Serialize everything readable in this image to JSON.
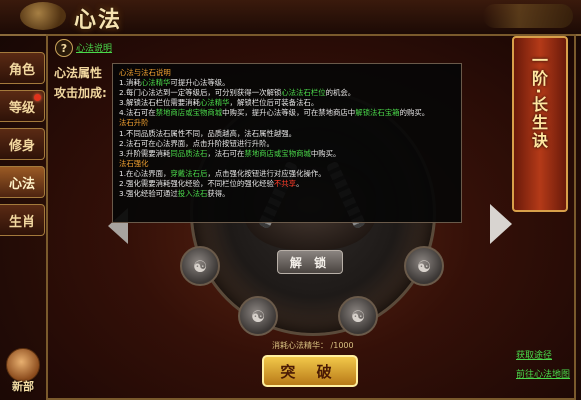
{
  "window": {
    "title": "心法"
  },
  "tabs": [
    {
      "label": "角色",
      "alert": false,
      "active": false
    },
    {
      "label": "等级",
      "alert": true,
      "active": false
    },
    {
      "label": "修身",
      "alert": false,
      "active": false
    },
    {
      "label": "心法",
      "alert": false,
      "active": true
    },
    {
      "label": "生肖",
      "alert": false,
      "active": false
    }
  ],
  "side": {
    "label": "新部"
  },
  "help": {
    "icon": "?",
    "link": "心法说明"
  },
  "attributes": {
    "title": "心法属性",
    "attack": "攻击加成:"
  },
  "tooltip": {
    "sections": [
      {
        "heading": "心法与法石说明",
        "lines": [
          [
            "1.消耗",
            "心法精华",
            "可提升心法等级。"
          ],
          [
            "2.每门心法达到一定等级后，可分别获得一次解锁",
            "心法法石栏位",
            "的机会。"
          ],
          [
            "3.解锁法石栏位需要消耗",
            "心法精华",
            "，解锁栏位后可装备法石。"
          ],
          [
            "4.法石可在",
            "禁地商店或宝物商城",
            "中购买，提升心法等级，可在禁地商店中",
            "解锁法石宝箱",
            "的购买。"
          ]
        ]
      },
      {
        "heading": "法石升阶",
        "lines": [
          [
            "1.不同品质法石属性不同，品质越高，法石属性越强。"
          ],
          [
            "2.法石可在心法界面，点击升阶按钮进行升阶。"
          ],
          [
            "3.升阶需要消耗",
            "同品质法石",
            "，法石可在",
            "禁地商店或宝物商城",
            "中购买。"
          ]
        ]
      },
      {
        "heading": "法石强化",
        "lines": [
          [
            "1.在心法界面，",
            "穿戴法石后",
            "，点击强化按钮进行对应强化操作。"
          ],
          [
            "2.强化需要消耗强化经验，不同栏位的强化经验",
            "不共享",
            "。"
          ],
          [
            "3.强化经验可通过",
            "投入法石",
            "获得。"
          ]
        ]
      }
    ]
  },
  "wheel": {
    "unlock_label": "解 锁",
    "socket_icon": "meditating-figure-icon",
    "consume_text": "消耗心法精华：  /1000"
  },
  "actions": {
    "breakthrough_label": "突 破"
  },
  "banner": {
    "text": "一阶·长生诀"
  },
  "links": {
    "obtain": "获取途径",
    "visit": "前往心法地图"
  },
  "colors": {
    "accent": "#f2d8a0",
    "link": "#4ad84a",
    "highlight": "#f0a030",
    "warn": "#ff3c28"
  }
}
